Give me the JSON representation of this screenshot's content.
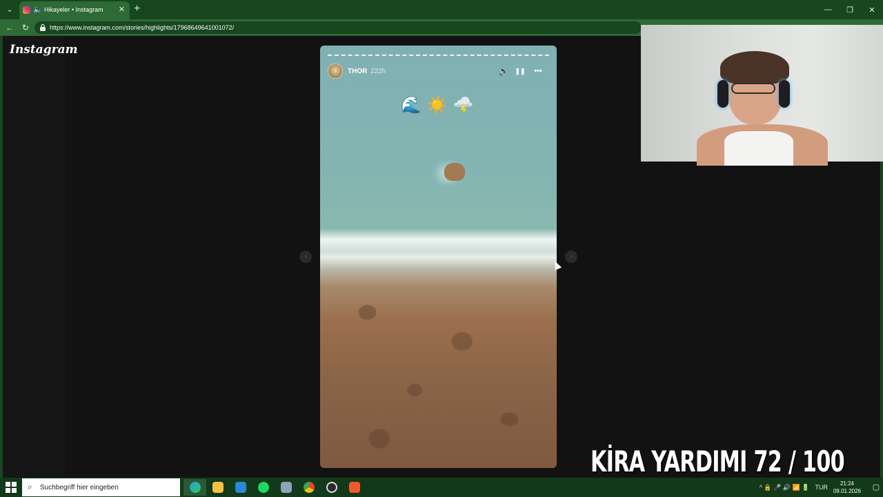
{
  "browser": {
    "tab_title": "Hikayeler • Instagram",
    "url": "https://www.instagram.com/stories/highlights/17968649641001072/",
    "tab_close": "✕",
    "new_tab": "+",
    "tab_list": "⌄"
  },
  "window_controls": {
    "minimize": "—",
    "restore": "❐",
    "close": "✕"
  },
  "nav": {
    "back": "←",
    "reload": "↻"
  },
  "page": {
    "logo": "Instagram"
  },
  "story": {
    "username": "THOR",
    "time": "222h",
    "emojis": "🌊☀️🌩️",
    "mute_icon": "🔈",
    "pause_icon": "❚❚",
    "more_icon": "•••"
  },
  "story_nav": {
    "prev": "‹",
    "next": "›"
  },
  "overlay": {
    "text": "KİRA YARDIMI  72 / 100"
  },
  "taskbar": {
    "search_placeholder": "Suchbegriff hier eingeben",
    "search_icon": "⌕",
    "language": "TUR",
    "time": "21:24",
    "date": "09.01.2026",
    "tray_icons": "^  🔒  🎤  🔊  📶  🔋",
    "notification_icon": "▢"
  },
  "colors": {
    "browser_green": "#17461f",
    "tab_green": "#2d6a36",
    "page_bg": "#121212"
  }
}
